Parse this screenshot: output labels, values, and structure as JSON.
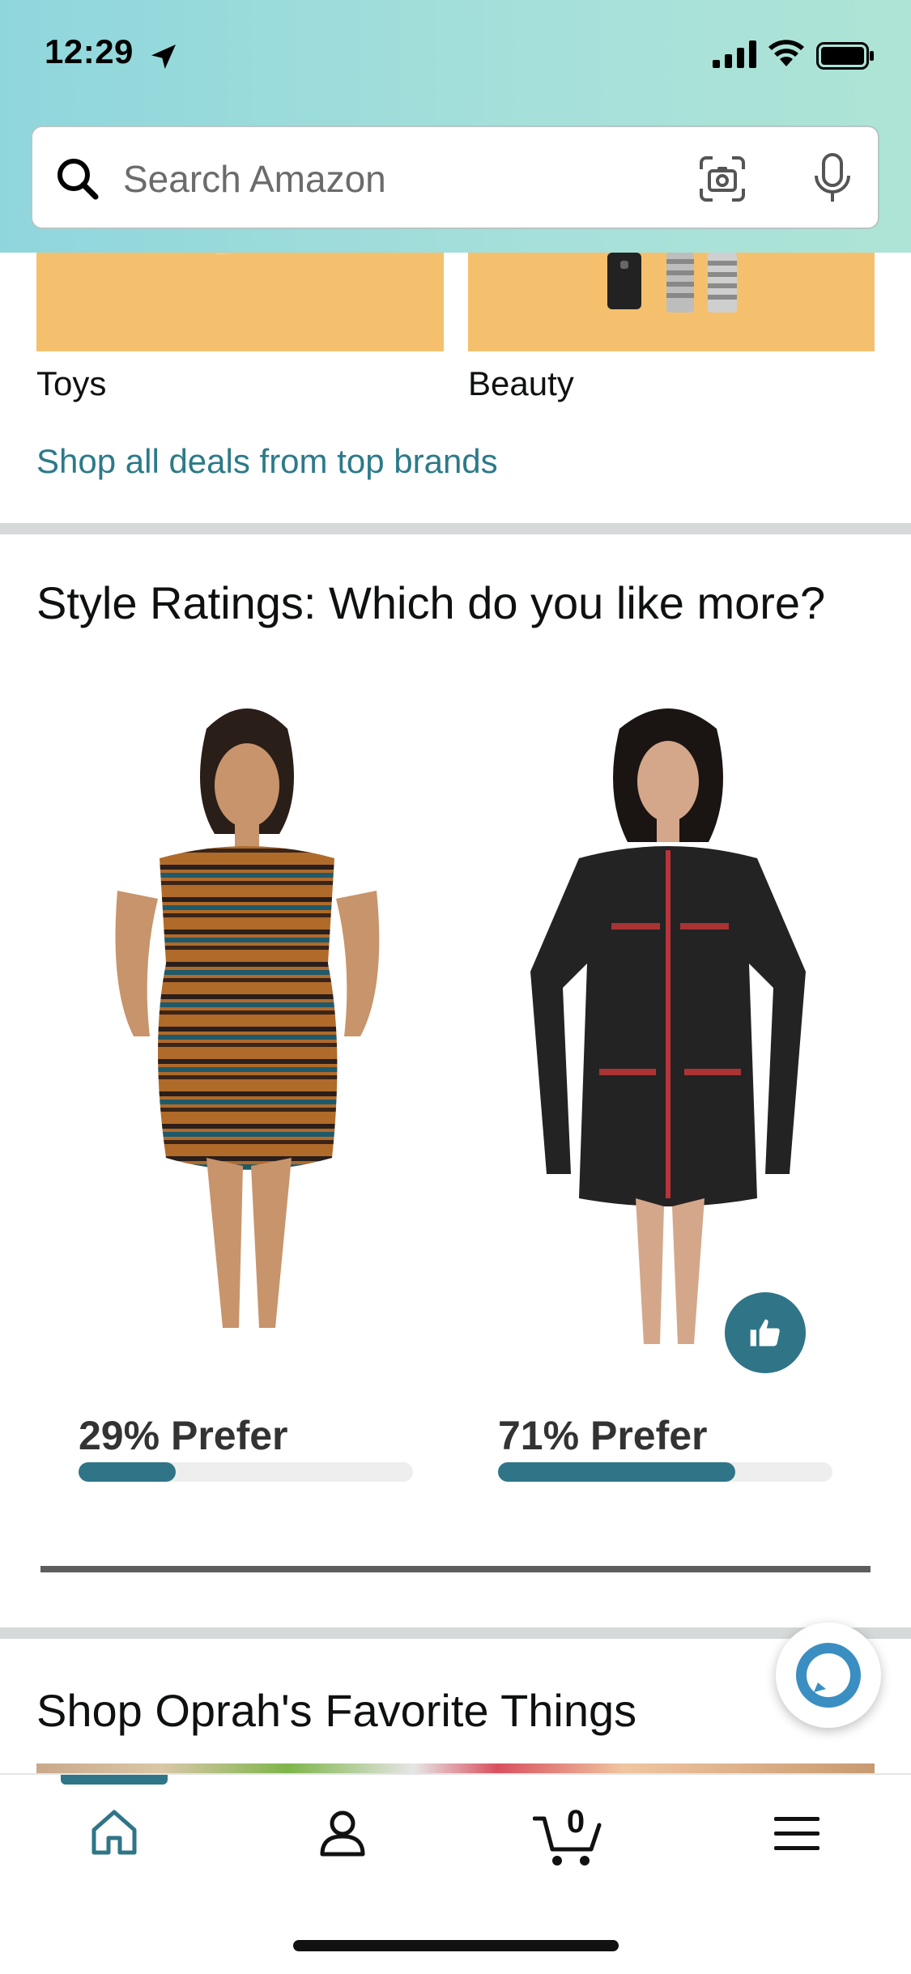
{
  "status_bar": {
    "time": "12:29"
  },
  "search": {
    "placeholder": "Search Amazon"
  },
  "categories": [
    {
      "label": "Toys"
    },
    {
      "label": "Beauty"
    }
  ],
  "deals_link": "Shop all deals from top brands",
  "style_ratings": {
    "title": "Style Ratings: Which do you like more?",
    "options": [
      {
        "prefer_label": "29% Prefer",
        "percent": 29
      },
      {
        "prefer_label": "71% Prefer",
        "percent": 71,
        "liked": true
      }
    ]
  },
  "next_section": {
    "title": "Shop Oprah's Favorite Things"
  },
  "bottom_nav": {
    "cart_count": "0",
    "active_tab": "home"
  },
  "colors": {
    "accent": "#2f7587",
    "link": "#2c7a89",
    "tile_bg": "#f5c06d"
  }
}
